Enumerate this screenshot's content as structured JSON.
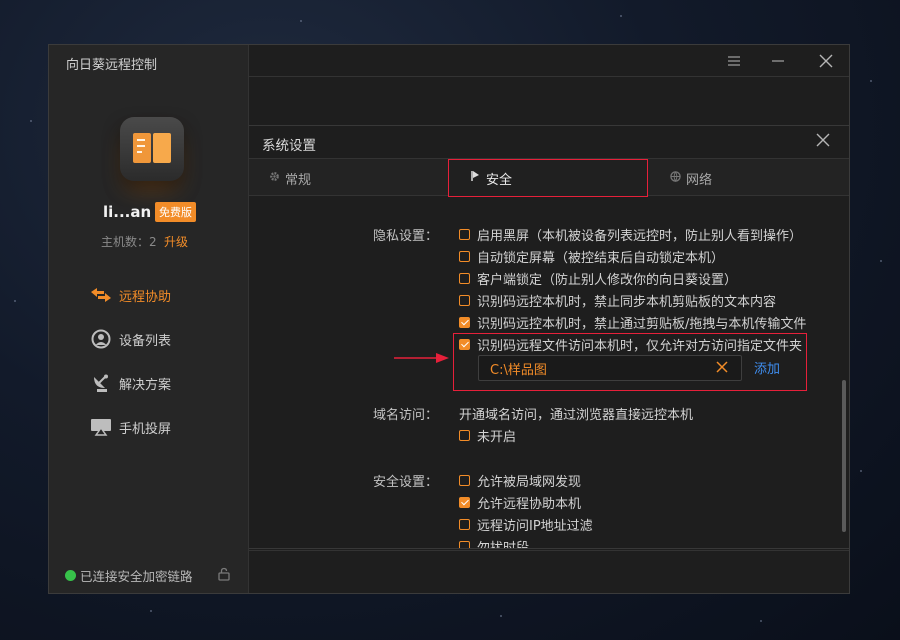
{
  "app": {
    "title": "向日葵远程控制",
    "username": "li...an",
    "badge": "免费版",
    "host_count": "主机数：2",
    "upgrade": "升级"
  },
  "colors": {
    "accent": "#f28c28",
    "highlight": "#e6203a",
    "link": "#3f8ef0",
    "status_ok": "#37c24a"
  },
  "sidebar": {
    "items": [
      {
        "label": "远程协助",
        "icon": "remote-assist-icon",
        "active": true
      },
      {
        "label": "设备列表",
        "icon": "device-list-icon",
        "active": false
      },
      {
        "label": "解决方案",
        "icon": "satellite-dish-icon",
        "active": false
      },
      {
        "label": "手机投屏",
        "icon": "screen-cast-icon",
        "active": false
      }
    ],
    "status": "已连接安全加密链路"
  },
  "dialog": {
    "title": "系统设置",
    "tabs": [
      {
        "label": "常规",
        "icon": "gear-icon",
        "active": false
      },
      {
        "label": "安全",
        "icon": "flag-icon",
        "active": true
      },
      {
        "label": "网络",
        "icon": "globe-icon",
        "active": false
      }
    ]
  },
  "security": {
    "privacy_label": "隐私设置：",
    "privacy_options": [
      {
        "label": "启用黑屏（本机被设备列表远控时，防止别人看到操作）",
        "checked": false
      },
      {
        "label": "自动锁定屏幕（被控结束后自动锁定本机）",
        "checked": false
      },
      {
        "label": "客户端锁定（防止别人修改你的向日葵设置）",
        "checked": false
      },
      {
        "label": "识别码远控本机时，禁止同步本机剪贴板的文本内容",
        "checked": false
      },
      {
        "label": "识别码远控本机时，禁止通过剪贴板/拖拽与本机传输文件",
        "checked": true
      },
      {
        "label": "识别码远程文件访问本机时，仅允许对方访问指定文件夹",
        "checked": true
      }
    ],
    "folder_value": "C:\\样品图",
    "add_label": "添加",
    "domain_label": "域名访问：",
    "domain_desc": "开通域名访问，通过浏览器直接远控本机",
    "domain_option": {
      "label": "未开启",
      "checked": false
    },
    "safety_label": "安全设置：",
    "safety_options": [
      {
        "label": "允许被局域网发现",
        "checked": false
      },
      {
        "label": "允许远程协助本机",
        "checked": true
      },
      {
        "label": "远程访问IP地址过滤",
        "checked": false
      },
      {
        "label": "勿扰时段",
        "checked": false
      }
    ]
  }
}
